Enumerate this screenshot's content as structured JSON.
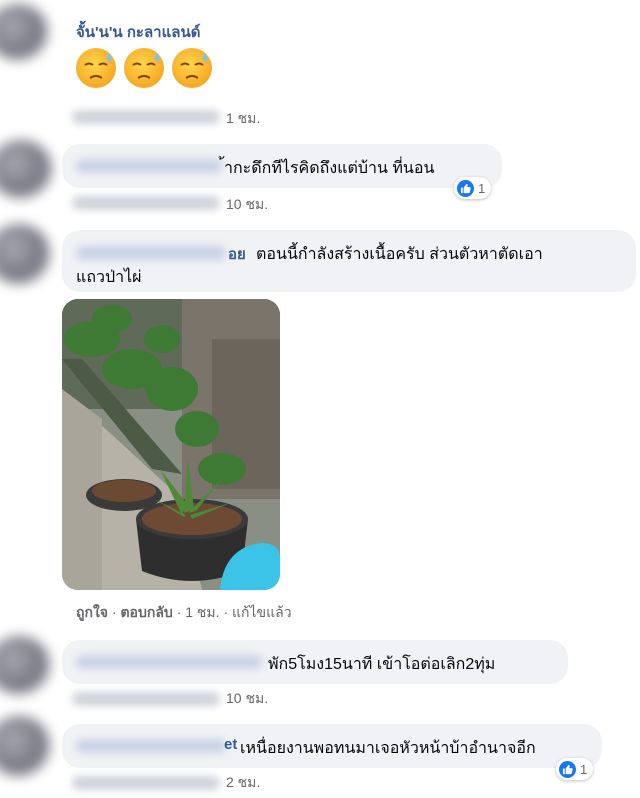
{
  "comment1": {
    "name": "จั้น'น'น กะลาแลนด์",
    "emojis": [
      "downcast-face-with-sweat",
      "downcast-face-with-sweat",
      "downcast-face-with-sweat"
    ],
    "time": "1 ชม."
  },
  "comment2": {
    "text": "้ากะดึกทีไรคิดถึงแต่บ้าน ที่นอน",
    "reaction_count": "1",
    "time": "10 ชม."
  },
  "comment3": {
    "name_tail": "อย",
    "text_line1": "ตอนนี้กำลังสร้างเนื้อครับ ส่วนตัวหาตัดเอา",
    "text_line2": "แถวป่าไผ่",
    "actions": {
      "like": "ถูกใจ",
      "reply": "ตอบกลับ",
      "time": "1 ชม.",
      "edited": "แก้ไขแล้ว",
      "separator": "·"
    }
  },
  "comment4": {
    "text": "พัก5โมง15นาที เข้าโอต่อเลิก2ทุ่ม",
    "time": "10 ชม."
  },
  "comment5": {
    "name_tail": "et",
    "text": "เหนื่อยงานพอทนมาเจอหัวหน้าบ้าอำนาจอีก",
    "reaction_count": "1",
    "time": "2 ชม."
  },
  "colors": {
    "bubble": "#f0f2f5",
    "name": "#385898",
    "meta": "#65676b",
    "like_blue": "#1877f2"
  }
}
